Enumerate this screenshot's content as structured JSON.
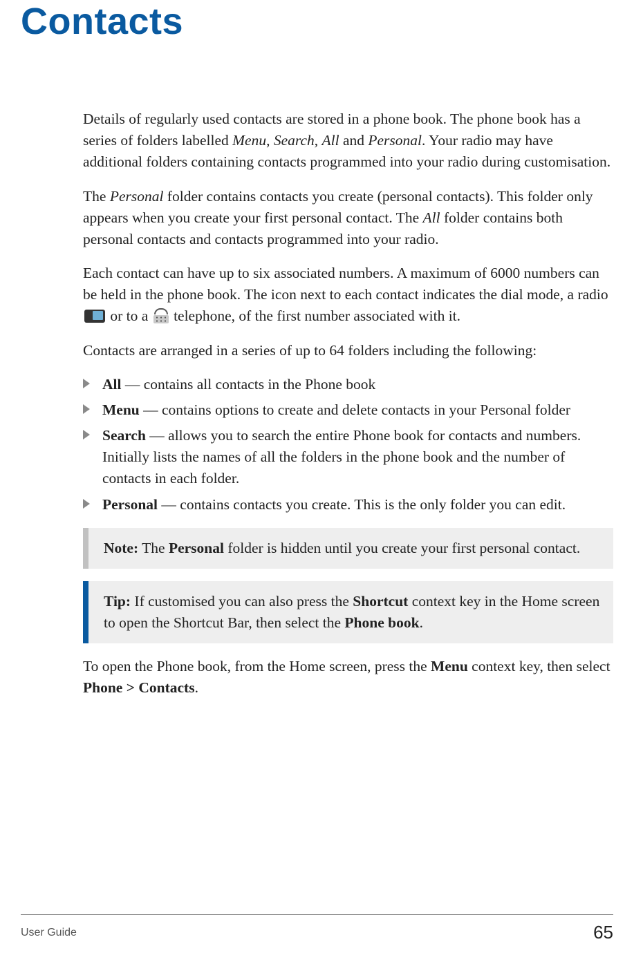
{
  "title": "Contacts",
  "para1": {
    "t1": "Details of regularly used contacts are stored in a phone book. The phone book has a series of folders labelled ",
    "i1": "Menu",
    "c1": ", ",
    "i2": "Search",
    "c2": ", ",
    "i3": "All",
    "c3": " and ",
    "i4": "Personal",
    "t2": ". Your radio may have additional folders containing contacts programmed into your radio during customisation."
  },
  "para2": {
    "t1": "The ",
    "i1": "Personal",
    "t2": " folder contains contacts you create (personal contacts). This folder only appears when you create your first personal contact. The ",
    "i2": "All",
    "t3": " folder contains both personal contacts and contacts programmed into your radio."
  },
  "para3": {
    "t1": "Each contact can have up to six associated numbers. A maximum of 6000 numbers can be held in the phone book. The icon next to each contact indicates the dial mode, a radio ",
    "t2": " or to a ",
    "t3": " telephone, of the first number associated with it."
  },
  "para4": "Contacts are arranged in a series of up to 64 folders including the following:",
  "bullets": [
    {
      "term": "All",
      "dash": " — ",
      "desc": "contains all contacts in the Phone book"
    },
    {
      "term": "Menu",
      "dash": " — ",
      "desc": "contains options to create and delete contacts in your Personal folder"
    },
    {
      "term": "Search",
      "dash": " — ",
      "desc": "allows you to search the entire Phone book for contacts and numbers. Initially lists the names of all the folders in the phone book and the number of contacts in each folder."
    },
    {
      "term": "Personal",
      "dash": " — ",
      "desc": "contains contacts you create. This is the only folder you can edit."
    }
  ],
  "note": {
    "label": "Note:",
    "t1": "  The ",
    "b1": "Personal",
    "t2": " folder is hidden until you create your first personal contact."
  },
  "tip": {
    "label": "Tip:",
    "t1": "  If customised you can also press the ",
    "b1": "Shortcut",
    "t2": " context key in the Home screen to open the Shortcut Bar, then select the ",
    "b2": "Phone book",
    "t3": "."
  },
  "para5": {
    "t1": "To open the Phone book, from the Home screen, press the ",
    "b1": "Menu",
    "t2": " context key, then select ",
    "b2": "Phone > Contacts",
    "t3": "."
  },
  "footer": {
    "left": "User Guide",
    "right": "65"
  }
}
